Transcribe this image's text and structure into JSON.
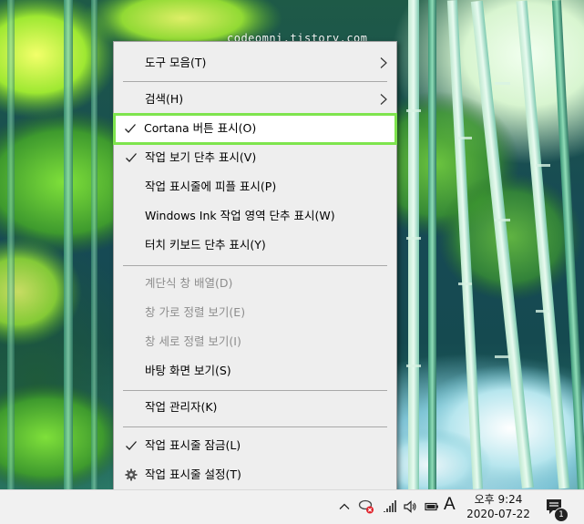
{
  "watermark": "codeomni.tistory.com",
  "context_menu": {
    "items": [
      {
        "label": "도구 모음(T)",
        "submenu": true
      },
      {
        "label": "검색(H)",
        "submenu": true
      },
      {
        "label": "Cortana 버튼 표시(O)",
        "checked": true,
        "highlighted": true
      },
      {
        "label": "작업 보기 단추 표시(V)",
        "checked": true
      },
      {
        "label": "작업 표시줄에 피플 표시(P)"
      },
      {
        "label": "Windows Ink 작업 영역 단추 표시(W)"
      },
      {
        "label": "터치 키보드 단추 표시(Y)"
      },
      {
        "label": "계단식 창 배열(D)",
        "disabled": true
      },
      {
        "label": "창 가로 정렬 보기(E)",
        "disabled": true
      },
      {
        "label": "창 세로 정렬 보기(I)",
        "disabled": true
      },
      {
        "label": "바탕 화면 보기(S)"
      },
      {
        "label": "작업 관리자(K)"
      },
      {
        "label": "작업 표시줄 잠금(L)",
        "checked": true
      },
      {
        "label": "작업 표시줄 설정(T)",
        "icon": "gear-icon"
      }
    ]
  },
  "taskbar": {
    "ime_indicator": "A",
    "clock": {
      "time": "오후 9:24",
      "date": "2020-07-22"
    },
    "notification_count": "1",
    "tray_icons": [
      "chevron-up-icon",
      "network-error-icon",
      "wifi-icon",
      "volume-icon",
      "battery-icon"
    ]
  },
  "colors": {
    "highlight_border": "#7ee44d",
    "menu_bg": "#eeeeee",
    "disabled_text": "#8d8d8d"
  }
}
